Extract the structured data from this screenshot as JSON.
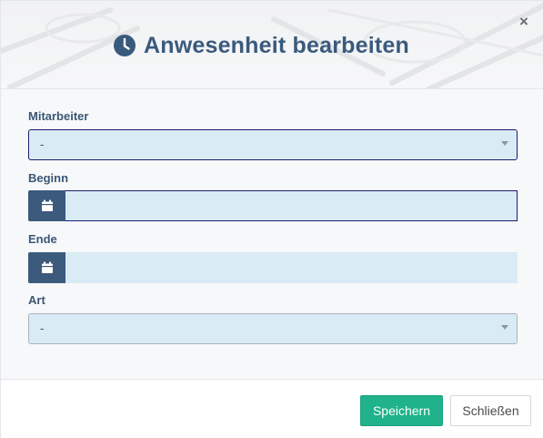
{
  "dialog": {
    "title": "Anwesenheit bearbeiten",
    "title_icon": "clock-icon",
    "close_symbol": "×",
    "close_icon": "close-icon"
  },
  "form": {
    "employee": {
      "label": "Mitarbeiter",
      "value": "-"
    },
    "start": {
      "label": "Beginn",
      "value": "",
      "icon": "calendar-icon"
    },
    "end": {
      "label": "Ende",
      "value": "",
      "icon": "calendar-icon"
    },
    "type": {
      "label": "Art",
      "value": "-"
    }
  },
  "footer": {
    "save_label": "Speichern",
    "close_label": "Schließen"
  },
  "colors": {
    "accent": "#3a5a7d",
    "input_bg": "#d9ebf5",
    "save": "#1fb28b"
  }
}
